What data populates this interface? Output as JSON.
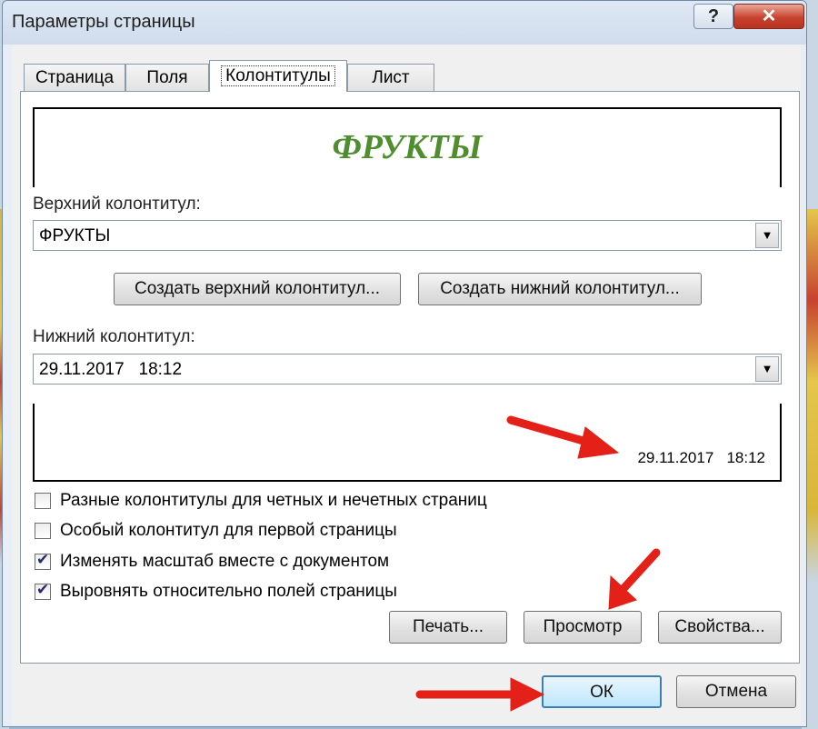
{
  "window": {
    "title": "Параметры страницы"
  },
  "titlebar_buttons": {
    "help": "?",
    "close": "✕"
  },
  "tabs": [
    {
      "label": "Страница"
    },
    {
      "label": "Поля"
    },
    {
      "label": "Колонтитулы",
      "active": true
    },
    {
      "label": "Лист"
    }
  ],
  "header_preview": {
    "text": "ФРУКТЫ",
    "color": "#4f8e2f"
  },
  "header_field": {
    "label": "Верхний колонтитул:",
    "value": "ФРУКТЫ"
  },
  "buttons": {
    "create_header": "Создать верхний колонтитул...",
    "create_footer": "Создать нижний колонтитул...",
    "print": "Печать...",
    "preview": "Просмотр",
    "properties": "Свойства...",
    "ok": "ОК",
    "cancel": "Отмена"
  },
  "footer_field": {
    "label": "Нижний колонтитул:",
    "value": "29.11.2017   18:12"
  },
  "footer_preview": {
    "text": "29.11.2017   18:12"
  },
  "options": [
    {
      "label": "Разные колонтитулы для четных и нечетных страниц",
      "checked": false
    },
    {
      "label": "Особый колонтитул для первой страницы",
      "checked": false
    },
    {
      "label": "Изменять масштаб вместе с документом",
      "checked": true
    },
    {
      "label": "Выровнять относительно полей страницы",
      "checked": true
    }
  ],
  "annotation_color": "#e32119"
}
